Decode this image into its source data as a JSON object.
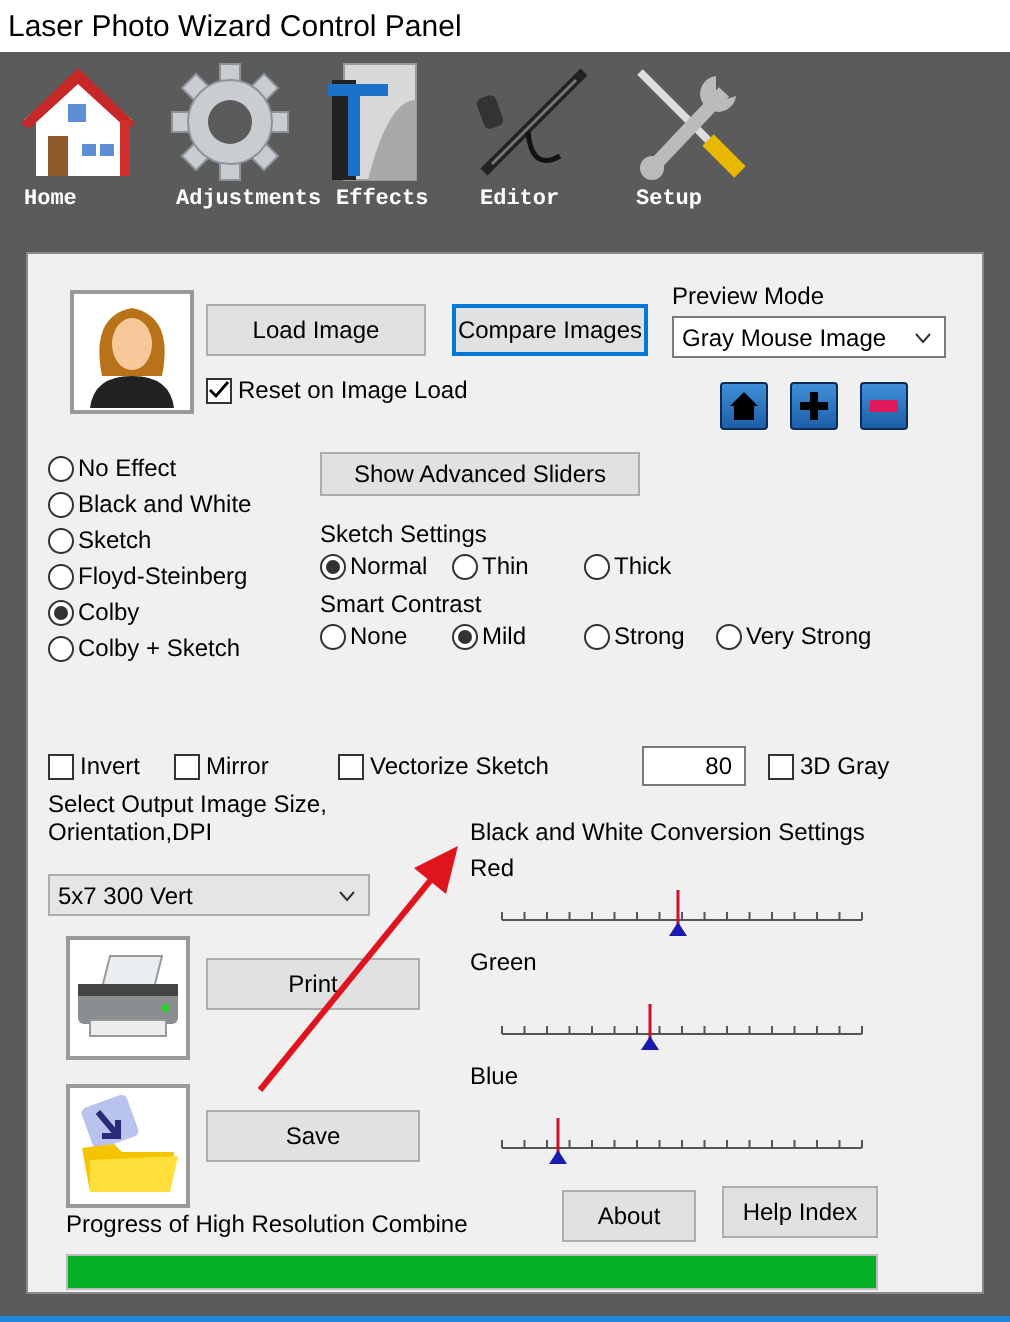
{
  "window": {
    "title": "Laser Photo Wizard Control Panel"
  },
  "toolbar": [
    {
      "label": "Home",
      "kind": "house"
    },
    {
      "label": "Adjustments",
      "kind": "gear"
    },
    {
      "label": "Effects",
      "kind": "page"
    },
    {
      "label": "Editor",
      "kind": "airbrush"
    },
    {
      "label": "Setup",
      "kind": "tools"
    }
  ],
  "image_buttons": [
    {
      "label": "Load Image",
      "focused": false
    },
    {
      "label": "Compare Images",
      "focused": true
    }
  ],
  "reset_on_load": {
    "label": "Reset on Image Load",
    "checked": true
  },
  "preview_mode": {
    "label": "Preview Mode",
    "value": "Gray Mouse Image"
  },
  "zoom_buttons": [
    {
      "kind": "home"
    },
    {
      "kind": "plus"
    },
    {
      "kind": "minus"
    }
  ],
  "effects": [
    {
      "label": "No Effect",
      "selected": false
    },
    {
      "label": "Black and White",
      "selected": false
    },
    {
      "label": "Sketch",
      "selected": false
    },
    {
      "label": "Floyd-Steinberg",
      "selected": false
    },
    {
      "label": "Colby",
      "selected": true
    },
    {
      "label": "Colby + Sketch",
      "selected": false
    }
  ],
  "advanced_button": "Show Advanced Sliders",
  "sketch_settings": {
    "label": "Sketch Settings",
    "options": [
      {
        "label": "Normal",
        "selected": true
      },
      {
        "label": "Thin",
        "selected": false
      },
      {
        "label": "Thick",
        "selected": false
      }
    ]
  },
  "smart_contrast": {
    "label": "Smart Contrast",
    "options": [
      {
        "label": "None",
        "selected": false
      },
      {
        "label": "Mild",
        "selected": true
      },
      {
        "label": "Strong",
        "selected": false
      },
      {
        "label": "Very Strong",
        "selected": false
      }
    ]
  },
  "options": [
    {
      "kind": "checkbox",
      "label": "Invert",
      "checked": false
    },
    {
      "kind": "checkbox",
      "label": "Mirror",
      "checked": false
    },
    {
      "kind": "checkbox",
      "label": "Vectorize Sketch",
      "checked": false
    },
    {
      "kind": "number",
      "value": "80"
    },
    {
      "kind": "checkbox",
      "label": "3D Gray",
      "checked": false
    }
  ],
  "output": {
    "label_lines": [
      "Select Output Image Size,",
      "Orientation,DPI"
    ],
    "value": "5x7 300 Vert"
  },
  "print_button": "Print",
  "save_button": "Save",
  "bw_settings": {
    "title": "Black and White Conversion Settings",
    "channels": [
      {
        "name": "Red",
        "level": 0.49
      },
      {
        "name": "Green",
        "level": 0.41
      },
      {
        "name": "Blue",
        "level": 0.16
      }
    ]
  },
  "help_buttons": [
    "About",
    "Help Index"
  ],
  "progress": {
    "label": "Progress of High Resolution Combine",
    "level": 1
  }
}
